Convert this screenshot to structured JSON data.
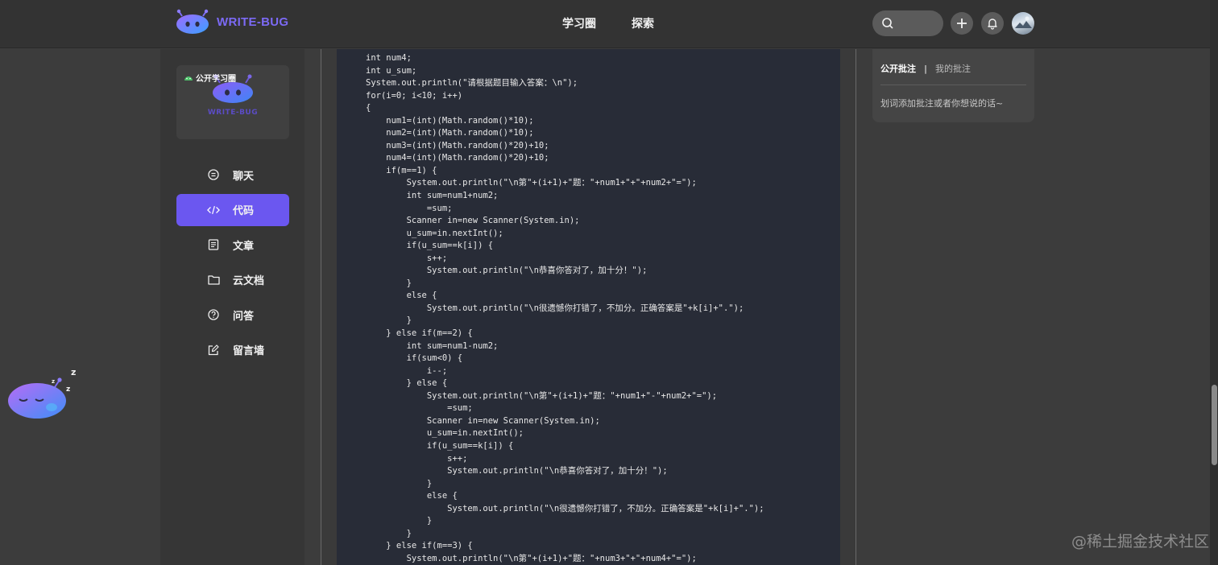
{
  "header": {
    "brand": "WRITE-BUG",
    "nav": [
      "学习圈",
      "探索"
    ],
    "search_placeholder": ""
  },
  "sidebar": {
    "circle_tag": "公开学习圈",
    "card_brand": "WRITE-BUG",
    "items": [
      {
        "label": "聊天",
        "icon": "chat-icon"
      },
      {
        "label": "代码",
        "icon": "code-icon"
      },
      {
        "label": "文章",
        "icon": "article-icon"
      },
      {
        "label": "云文档",
        "icon": "folder-icon"
      },
      {
        "label": "问答",
        "icon": "question-icon"
      },
      {
        "label": "留言墙",
        "icon": "edit-icon"
      }
    ],
    "active_item": "代码"
  },
  "code": {
    "lines": [
      "int num4;",
      "int u_sum;",
      "System.out.println(\"请根据题目输入答案：\\n\");",
      "for(i=0; i<10; i++)",
      "{",
      "    num1=(int)(Math.random()*10);",
      "    num2=(int)(Math.random()*10);",
      "    num3=(int)(Math.random()*20)+10;",
      "    num4=(int)(Math.random()*20)+10;",
      "    if(m==1) {",
      "        System.out.println(\"\\n第\"+(i+1)+\"题：\"+num1+\"+\"+num2+\"=\");",
      "        int sum=num1+num2;",
      "            =sum;",
      "        Scanner in=new Scanner(System.in);",
      "        u_sum=in.nextInt();",
      "        if(u_sum==k[i]) {",
      "            s++;",
      "            System.out.println(\"\\n恭喜你答对了，加十分！\");",
      "        }",
      "        else {",
      "            System.out.println(\"\\n很遗憾你打错了，不加分。正确答案是\"+k[i]+\".\");",
      "        }",
      "    } else if(m==2) {",
      "        int sum=num1-num2;",
      "        if(sum<0) {",
      "            i--;",
      "        } else {",
      "            System.out.println(\"\\n第\"+(i+1)+\"题：\"+num1+\"-\"+num2+\"=\");",
      "                =sum;",
      "            Scanner in=new Scanner(System.in);",
      "            u_sum=in.nextInt();",
      "            if(u_sum==k[i]) {",
      "                s++;",
      "                System.out.println(\"\\n恭喜你答对了，加十分！\");",
      "            }",
      "            else {",
      "                System.out.println(\"\\n很遗憾你打错了，不加分。正确答案是\"+k[i]+\".\");",
      "            }",
      "        }",
      "    } else if(m==3) {",
      "        System.out.println(\"\\n第\"+(i+1)+\"题：\"+num3+\"+\"+num4+\"=\");"
    ]
  },
  "annotations": {
    "tab_public": "公开批注",
    "separator": "|",
    "tab_mine": "我的批注",
    "hint": "划词添加批注或者你想说的话~"
  },
  "watermark": "@稀土掘金技术社区",
  "colors": {
    "accent": "#6b57f0",
    "brand": "#7c6af5",
    "code_bg": "#282c37"
  }
}
